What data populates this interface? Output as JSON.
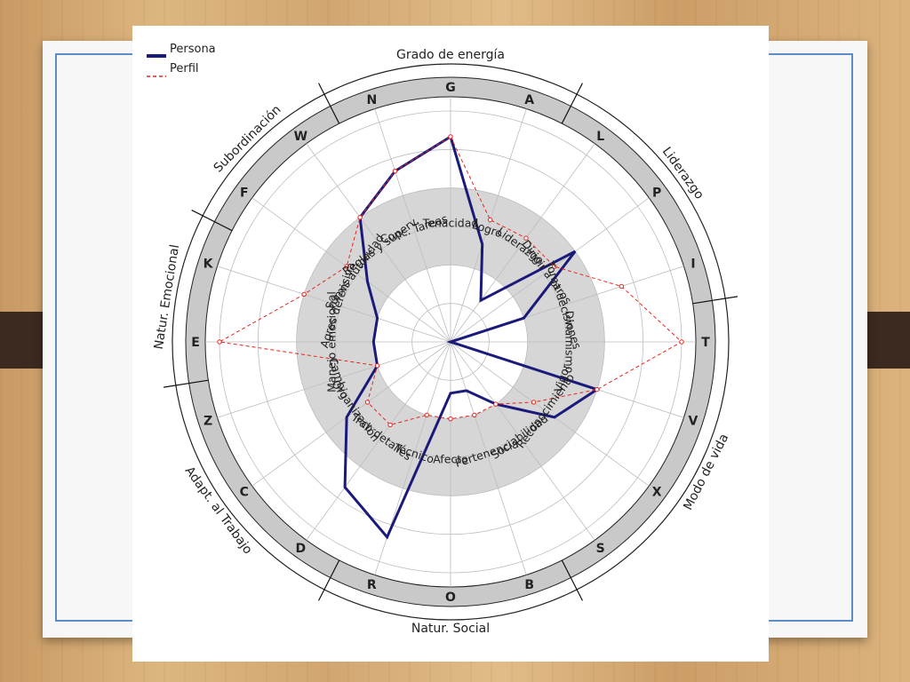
{
  "chart_data": {
    "type": "radar",
    "title": "",
    "legend": {
      "placement": "top-left",
      "entries": [
        {
          "label": "Persona",
          "color": "#1a1a7a",
          "style": "solid"
        },
        {
          "label": "Perfil",
          "color": "#e8231f",
          "style": "dashed"
        }
      ]
    },
    "rlim": [
      0,
      9
    ],
    "grid": true,
    "axes": [
      "G",
      "A",
      "L",
      "P",
      "I",
      "T",
      "V",
      "X",
      "S",
      "B",
      "O",
      "R",
      "D",
      "C",
      "Z",
      "E",
      "K",
      "F",
      "W",
      "N"
    ],
    "factor_names": [
      "Tenacidad",
      "Logro",
      "Liderazgo",
      "Dirigir a otros",
      "Toma decisiones",
      "Dinamismo",
      "Vigor",
      "Reconocimiento",
      "Sociabilidad",
      "Pertenencia",
      "Afecto",
      "Técnico",
      "Trab detalles",
      "Organización",
      "Cambio",
      "Manejo emocional",
      "Agres defensiva",
      "Sumis autoridad",
      "Reglas y superv.",
      "Conc. Tareas"
    ],
    "groups": [
      "Grado de energía",
      "Liderazgo",
      "Modo de vida",
      "Natur. Social",
      "Adapt. al Trabajo",
      "Natur. Emocional",
      "Subordinación"
    ],
    "series": [
      {
        "name": "Persona",
        "values": [
          8,
          4,
          2,
          6,
          3,
          0,
          6,
          5,
          3,
          2,
          2,
          8,
          7,
          5,
          3,
          3,
          3,
          4,
          6,
          7
        ]
      },
      {
        "name": "Perfil",
        "values": [
          8,
          5,
          5,
          5,
          7,
          9,
          6,
          4,
          3,
          3,
          3,
          3,
          4,
          4,
          3,
          9,
          6,
          5,
          6,
          7
        ]
      }
    ]
  }
}
